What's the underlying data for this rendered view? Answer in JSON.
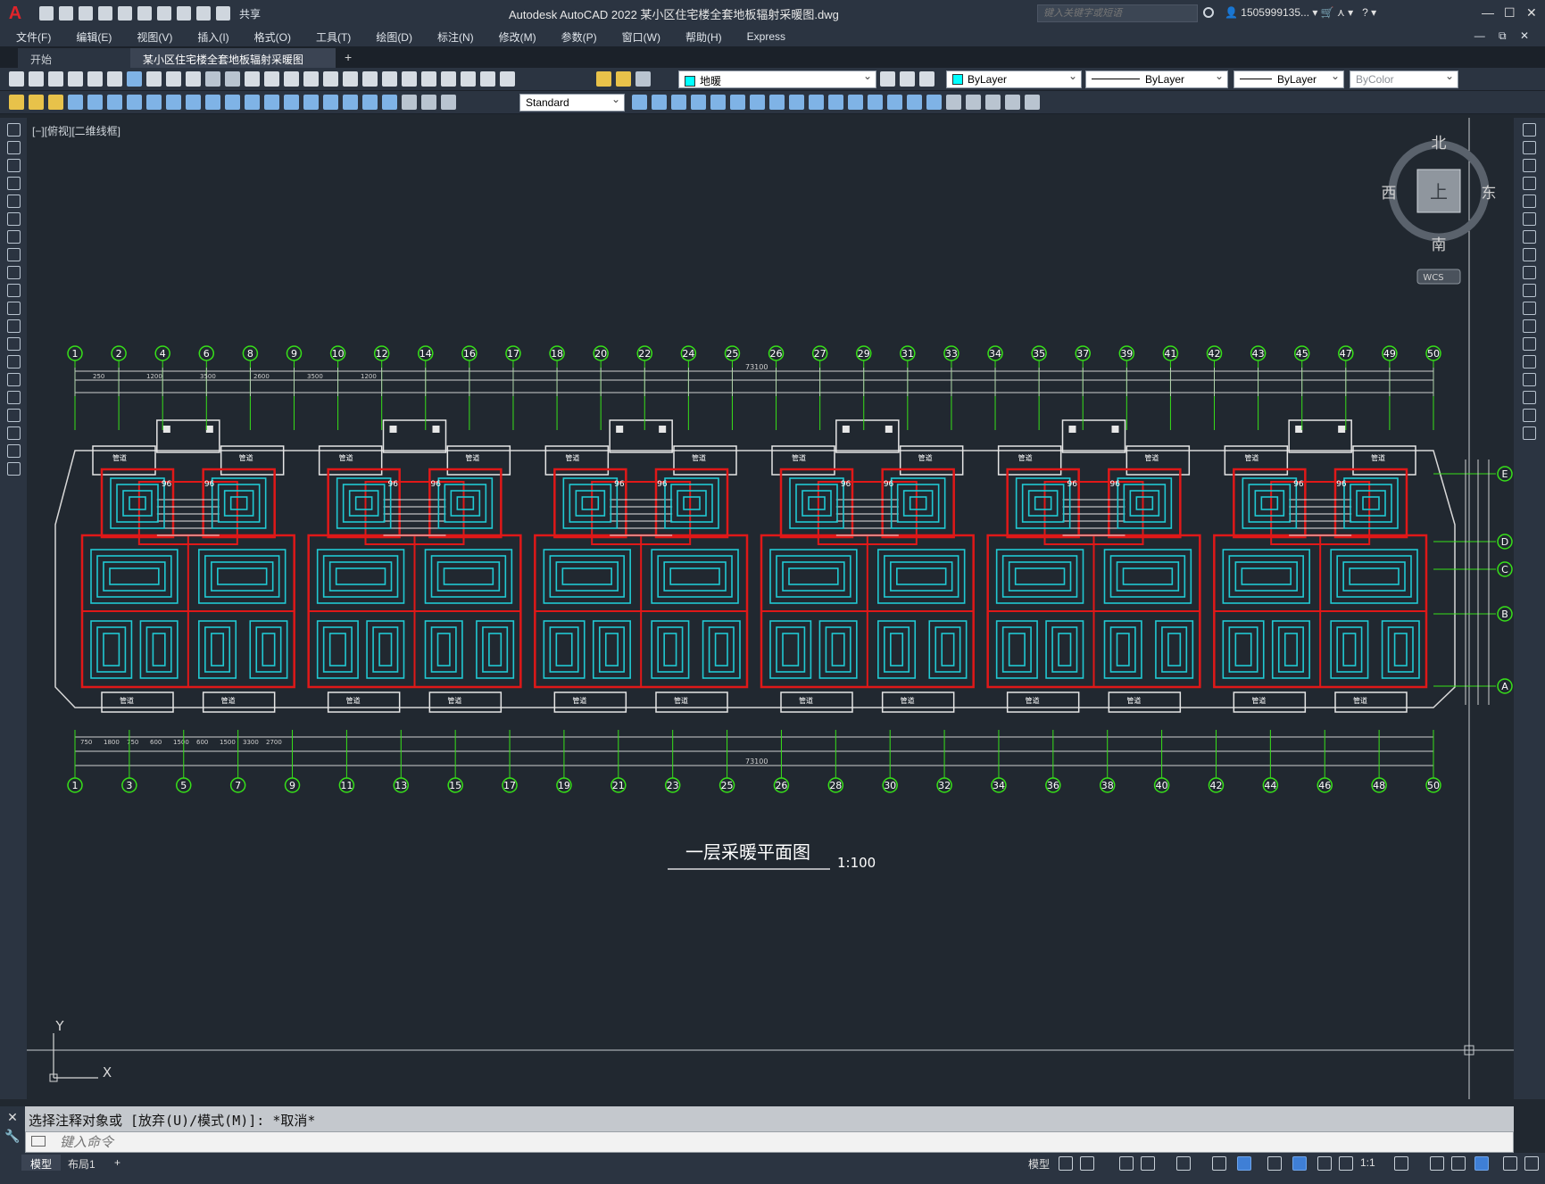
{
  "app": {
    "title": "Autodesk AutoCAD 2022    某小区住宅楼全套地板辐射采暖图.dwg",
    "logo": "A",
    "share_label": "共享",
    "search_placeholder": "键入关键字或短语",
    "user_name": "1505999135...",
    "window_controls": {
      "minimize": "—",
      "restore": "☐",
      "close": "✕"
    }
  },
  "menu": {
    "items": [
      "文件(F)",
      "编辑(E)",
      "视图(V)",
      "插入(I)",
      "格式(O)",
      "工具(T)",
      "绘图(D)",
      "标注(N)",
      "修改(M)",
      "参数(P)",
      "窗口(W)",
      "帮助(H)",
      "Express"
    ],
    "right_controls": "— ⧉ ✕"
  },
  "tabs": {
    "items": [
      {
        "label": "开始",
        "active": false
      },
      {
        "label": "某小区住宅楼全套地板辐射采暖图*",
        "active": true
      }
    ],
    "close_glyph": "✕",
    "add_glyph": "+"
  },
  "properties": {
    "layer": "地暖",
    "layer_color": "#00ffff",
    "color": "ByLayer",
    "linetype": "ByLayer",
    "lineweight": "ByLayer",
    "plotstyle": "ByColor",
    "text_style": "Standard"
  },
  "viewport": {
    "label": "[−][俯视][二维线框]"
  },
  "viewcube": {
    "north": "北",
    "south": "南",
    "east": "东",
    "west": "西",
    "face": "上",
    "coords": "WCS"
  },
  "drawing": {
    "title": "一层采暖平面图",
    "scale": "1:100",
    "top_axes": [
      "1",
      "2",
      "4",
      "6",
      "8",
      "9",
      "10",
      "12",
      "14",
      "16",
      "17",
      "18",
      "20",
      "22",
      "24",
      "25",
      "26",
      "27",
      "29",
      "31",
      "33",
      "34",
      "35",
      "37",
      "39",
      "41",
      "42",
      "43",
      "45",
      "47",
      "49",
      "50"
    ],
    "bottom_axes": [
      "1",
      "3",
      "5",
      "7",
      "9",
      "11",
      "13",
      "15",
      "17",
      "19",
      "21",
      "23",
      "25",
      "26",
      "28",
      "30",
      "32",
      "34",
      "36",
      "38",
      "40",
      "42",
      "44",
      "46",
      "48",
      "50"
    ],
    "side_axes": [
      "E",
      "D",
      "C",
      "B",
      "A"
    ],
    "total_dimension": "73100",
    "dim_labels": [
      "250",
      "1200",
      "3500",
      "2600",
      "3500",
      "1200"
    ],
    "bottom_dim_labels": [
      "750",
      "1800",
      "750",
      "600",
      "1500",
      "600",
      "1500",
      "3300",
      "2700"
    ],
    "room_label": "管道",
    "ucs": {
      "x": "X",
      "y": "Y"
    }
  },
  "command": {
    "history": "选择注释对象或 [放弃(U)/模式(M)]: *取消*",
    "placeholder": "键入命令"
  },
  "status": {
    "tabs": [
      {
        "label": "模型",
        "active": true
      },
      {
        "label": "布局1",
        "active": false
      }
    ],
    "add_label": "+",
    "model_label": "模型",
    "annotation_scale": "1:1"
  },
  "colors": {
    "pipe": "#21c9d2",
    "wall": "#e01818",
    "axis_bubble": "#37e019",
    "dimension": "#d0d0d0",
    "background": "#212830"
  }
}
